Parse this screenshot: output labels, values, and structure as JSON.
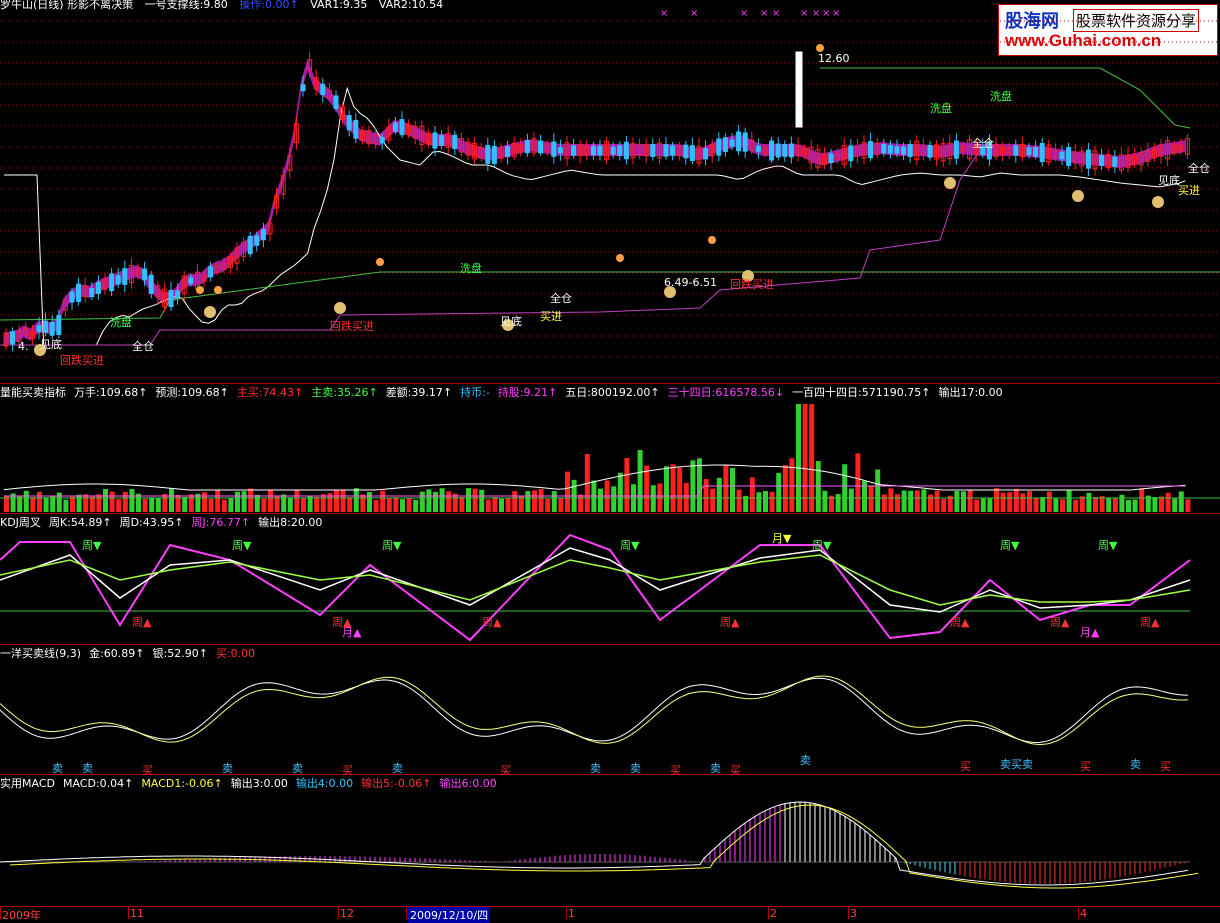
{
  "colors": {
    "up": "#ff2020",
    "down": "#30c0ff",
    "grid": "#b00000",
    "white": "#ffffff",
    "yellow": "#ffff40",
    "green": "#40ff40",
    "magenta": "#ff40ff",
    "cyan": "#40c0ff"
  },
  "main": {
    "title": "罗牛山(日线) 形影不离决策",
    "items": [
      {
        "text": "一号支撑线:9.80",
        "color": "#ffffff"
      },
      {
        "text": "操作:0.00↑",
        "color": "#3050ff"
      },
      {
        "text": "VAR1:9.35",
        "color": "#ffffff"
      },
      {
        "text": "VAR2:10.54",
        "color": "#ffffff"
      }
    ]
  },
  "vol": {
    "items": [
      {
        "text": "量能买卖指标",
        "color": "#ffffff"
      },
      {
        "text": "万手:109.68↑",
        "color": "#ffffff"
      },
      {
        "text": "预测:109.68↑",
        "color": "#ffffff"
      },
      {
        "text": "主买:74.43↑",
        "color": "#ff3030"
      },
      {
        "text": "主卖:35.26↑",
        "color": "#40ff40"
      },
      {
        "text": "差额:39.17↑",
        "color": "#ffffff"
      },
      {
        "text": "持币:-",
        "color": "#30c0ff"
      },
      {
        "text": "持股:9.21↑",
        "color": "#ff40ff"
      },
      {
        "text": "五日:800192.00↑",
        "color": "#ffffff"
      },
      {
        "text": "三十四日:616578.56↓",
        "color": "#ff40ff"
      },
      {
        "text": "一百四十四日:571190.75↑",
        "color": "#ffffff"
      },
      {
        "text": "输出17:0.00",
        "color": "#ffffff"
      }
    ]
  },
  "kdj": {
    "items": [
      {
        "text": "KDJ周叉",
        "color": "#ffffff"
      },
      {
        "text": "周K:54.89↑",
        "color": "#ffffff"
      },
      {
        "text": "周D:43.95↑",
        "color": "#ffffff"
      },
      {
        "text": "周J:76.77↑",
        "color": "#ff40ff"
      },
      {
        "text": "输出8:20.00",
        "color": "#ffffff"
      }
    ]
  },
  "line": {
    "items": [
      {
        "text": "一洋买卖线(9,3)",
        "color": "#ffffff"
      },
      {
        "text": "金:60.89↑",
        "color": "#ffffff"
      },
      {
        "text": "银:52.90↑",
        "color": "#ffffff"
      },
      {
        "text": "买:0.00",
        "color": "#ff3030"
      }
    ]
  },
  "macd": {
    "items": [
      {
        "text": "实用MACD",
        "color": "#ffffff"
      },
      {
        "text": "MACD:0.04↑",
        "color": "#ffffff"
      },
      {
        "text": "MACD1:-0.06↑",
        "color": "#ffff40"
      },
      {
        "text": "输出3:0.00",
        "color": "#ffffff"
      },
      {
        "text": "输出4:0.00",
        "color": "#30c0ff"
      },
      {
        "text": "输出5:-0.06↑",
        "color": "#ff3030"
      },
      {
        "text": "输出6:0.00",
        "color": "#ff40ff"
      }
    ]
  },
  "logo": {
    "l1": "股海网",
    "l2": "股票软件资源分享",
    "l3": "www.Guhai.com.cn"
  },
  "axis": {
    "labels": [
      "2009年",
      "11",
      "12",
      "2009/12/10/四",
      "1",
      "2",
      "3",
      "4"
    ],
    "selected": "2009/12/10/四"
  },
  "annotations": {
    "price_high": "12.60",
    "range": "6.49-6.51",
    "xipan": "洗盘",
    "quancang": "全仓",
    "jiandi": "见底",
    "mairu": "买进",
    "huidie": "回跌买进",
    "zhou_down": "周▼",
    "zhou_up": "周▲",
    "yue_up": "月▲",
    "yue_down": "月▼",
    "sell": "卖",
    "buy": "买",
    "sell_buy_sell": "卖买卖",
    "low_marker": "4.",
    "bottom_left": "见底"
  },
  "chart_data": {
    "type": "line",
    "title": "罗牛山(日线) 形影不离决策",
    "price": {
      "high": 12.6,
      "support": 9.8,
      "var1": 9.35,
      "var2": 10.54
    },
    "volume": {
      "wanshou": 109.68,
      "yuce": 109.68,
      "zhumai": 74.43,
      "zhumai_sell": 35.26,
      "chae": 39.17,
      "chigu": 9.21,
      "wuri": 800192.0,
      "sanshisi": 616578.56,
      "yibaisishisi": 571190.75
    },
    "kdj_weekly": {
      "K": 54.89,
      "D": 43.95,
      "J": 76.77
    },
    "yiyang": {
      "jin": 60.89,
      "yin": 52.9
    },
    "macd": {
      "MACD": 0.04,
      "MACD1": -0.06
    }
  }
}
